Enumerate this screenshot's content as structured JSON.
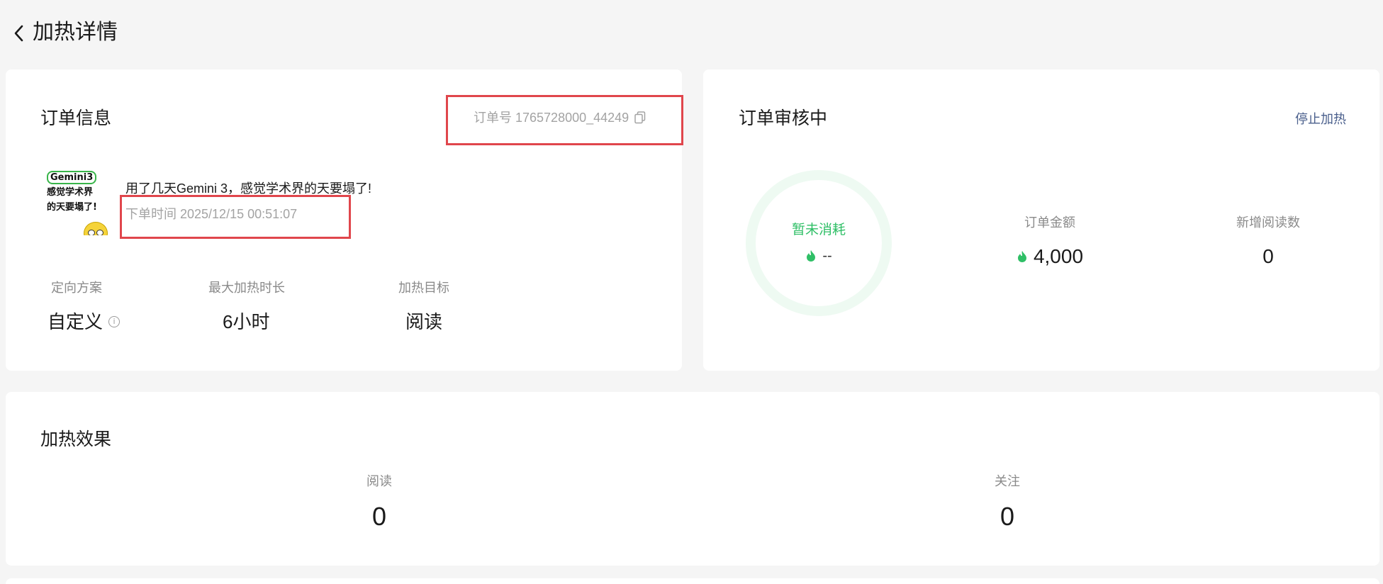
{
  "header": {
    "title": "加热详情"
  },
  "order_info": {
    "section_title": "订单信息",
    "order_number": "订单号 1765728000_44249",
    "article": {
      "thumbnail_lines": [
        "Gemini3",
        "感觉学术界",
        "的天要塌了!"
      ],
      "title": "用了几天Gemini 3，感觉学术界的天要塌了!",
      "order_time": "下单时间 2025/12/15 00:51:07"
    },
    "meta": [
      {
        "label": "定向方案",
        "value": "自定义",
        "has_info_icon": true
      },
      {
        "label": "最大加热时长",
        "value": "6小时",
        "has_info_icon": false
      },
      {
        "label": "加热目标",
        "value": "阅读",
        "has_info_icon": false
      }
    ]
  },
  "review": {
    "section_title": "订单审核中",
    "stop_label": "停止加热",
    "ring": {
      "label": "暂未消耗",
      "value": "--"
    },
    "stats": [
      {
        "label": "订单金额",
        "value": "4,000",
        "has_coin_icon": true
      },
      {
        "label": "新增阅读数",
        "value": "0",
        "has_coin_icon": false
      }
    ]
  },
  "effect": {
    "section_title": "加热效果",
    "metrics": [
      {
        "label": "阅读",
        "value": "0"
      },
      {
        "label": "关注",
        "value": "0"
      }
    ]
  },
  "colors": {
    "accent_green": "#2fbf66",
    "highlight_box": "#e0464c",
    "link": "#4a5f8c"
  }
}
